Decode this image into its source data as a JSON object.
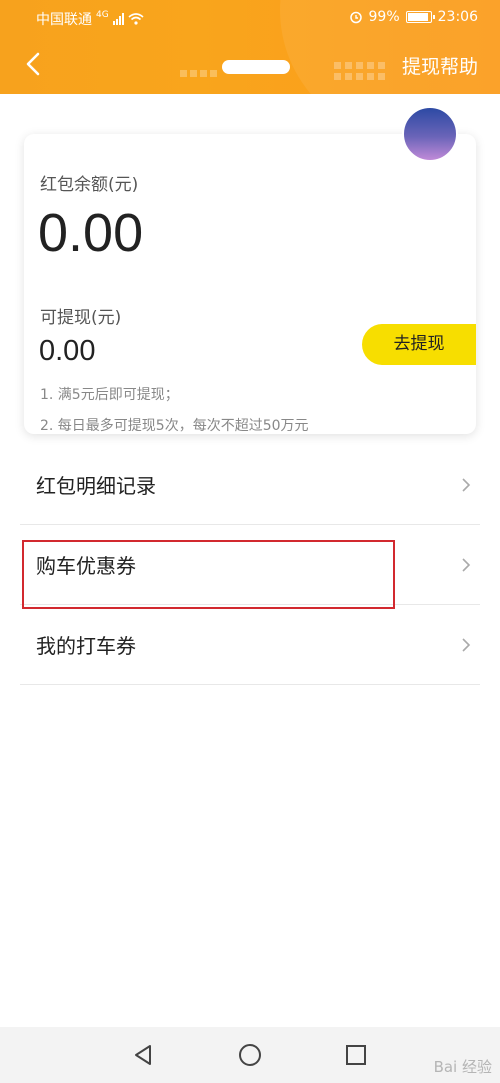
{
  "status_bar": {
    "carrier": "中国联通",
    "network": "4G",
    "battery": "99%",
    "battery_level": 0.99,
    "time": "23:06",
    "icons": [
      "signal-icon",
      "wifi-icon",
      "alarm-icon",
      "battery-icon"
    ]
  },
  "nav": {
    "back_icon": "chevron-left-icon",
    "title": "",
    "help_label": "提现帮助"
  },
  "wallet": {
    "balance_label": "红包余额(元)",
    "balance_value": "0.00",
    "withdrawable_label": "可提现(元)",
    "withdrawable_value": "0.00",
    "withdraw_button": "去提现",
    "rules": [
      "1. 满5元后即可提现；",
      "2. 每日最多可提现5次，每次不超过50万元"
    ]
  },
  "menu": {
    "items": [
      {
        "label": "红包明细记录"
      },
      {
        "label": "购车优惠券"
      },
      {
        "label": "我的打车券"
      }
    ],
    "highlighted_index": 1
  },
  "bottom_nav": [
    "back-triangle-icon",
    "home-circle-icon",
    "recents-square-icon"
  ],
  "watermark": "Bai 经验",
  "colors": {
    "header": "#f9a51c",
    "withdraw_button": "#f7de00",
    "highlight_border": "#d2292f"
  }
}
